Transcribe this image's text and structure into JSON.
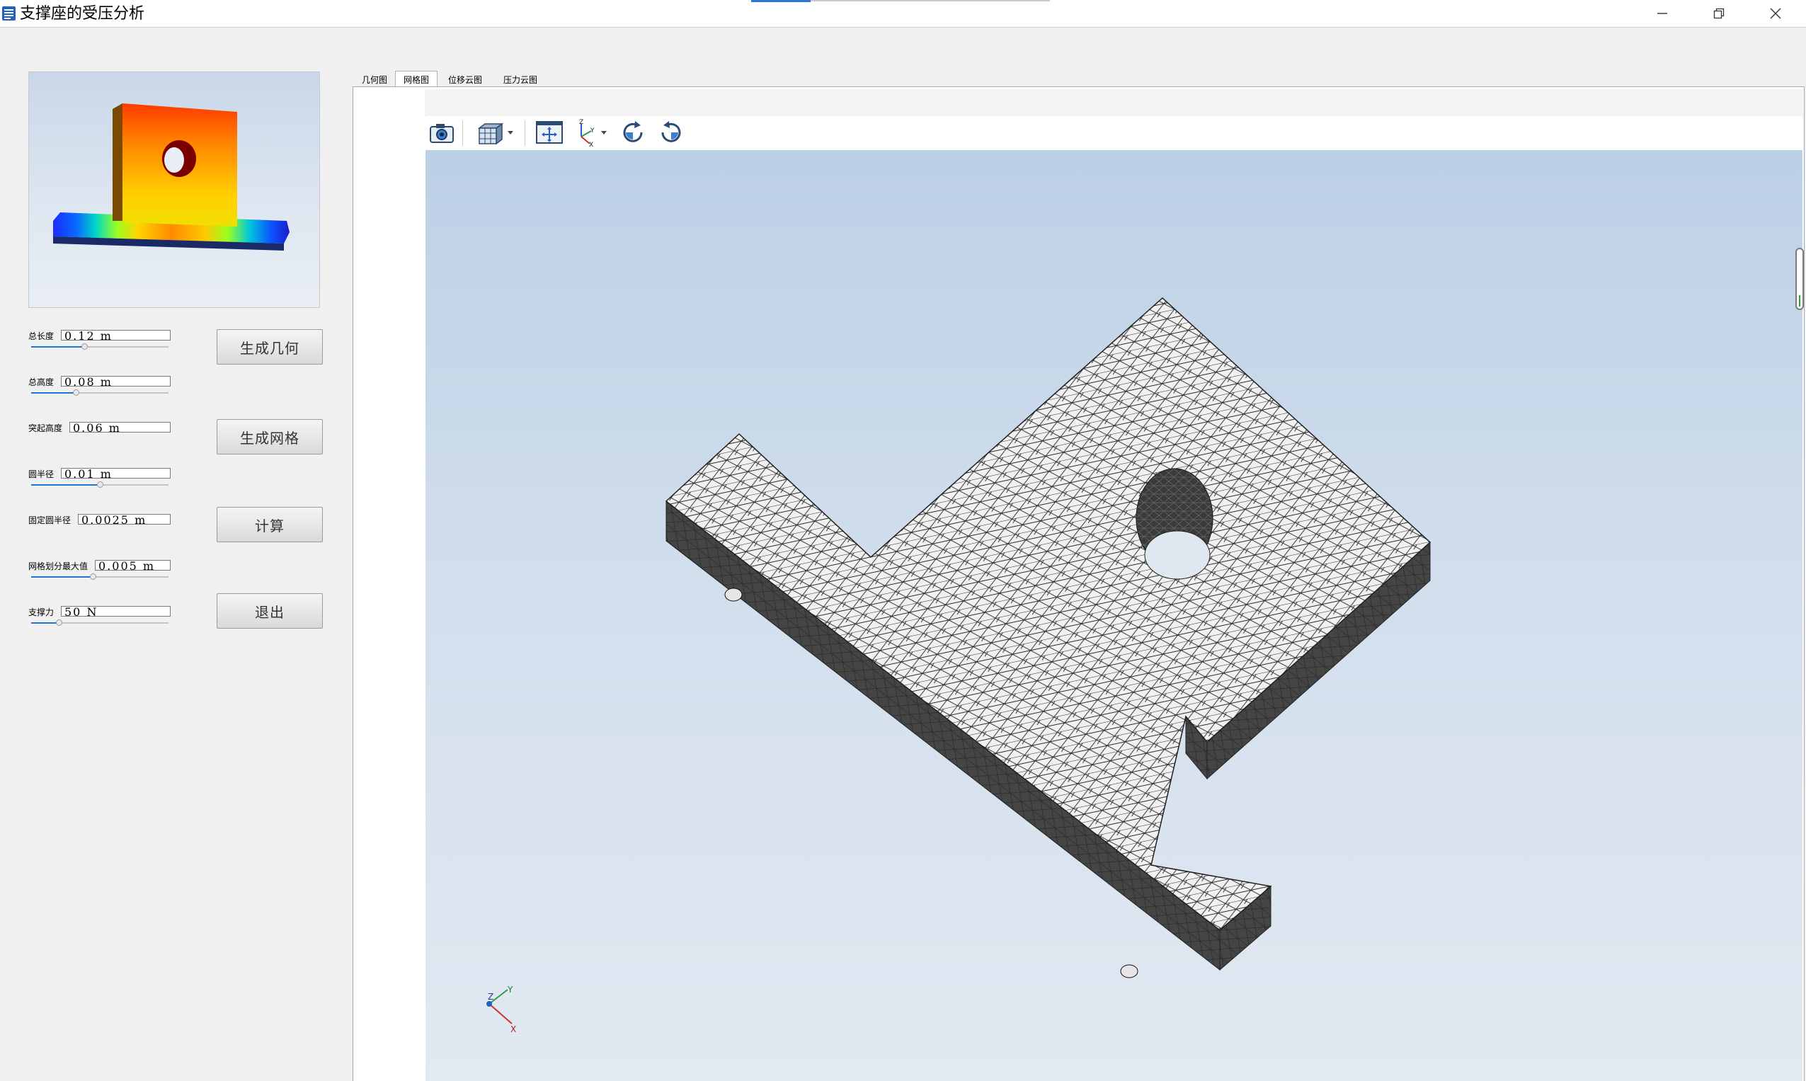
{
  "window": {
    "title": "支撑座的受压分析",
    "controls": [
      "minimize-icon",
      "restore-icon",
      "close-icon"
    ]
  },
  "params": [
    {
      "label": "总长度",
      "value": "0.12 m",
      "slider_fraction": 0.25
    },
    {
      "label": "总高度",
      "value": "0.08 m",
      "slider_fraction": 0.2
    },
    {
      "label": "突起高度",
      "value": "0.06 m",
      "slider_fraction": 0.0
    },
    {
      "label": "圆半径",
      "value": "0.01 m",
      "slider_fraction": 0.5
    },
    {
      "label": "固定圆半径",
      "value": "0.0025 m",
      "slider_fraction": 0.0
    },
    {
      "label": "网格划分最大值",
      "value": "0.005 m",
      "slider_fraction": 0.45
    },
    {
      "label": "支撑力",
      "value": "50 N",
      "slider_fraction": 0.15
    }
  ],
  "buttons": {
    "generate_geometry": "生成几何",
    "generate_mesh": "生成网格",
    "compute": "计算",
    "exit": "退出"
  },
  "tabs": [
    {
      "label": "几何图",
      "active": false
    },
    {
      "label": "网格图",
      "active": true
    },
    {
      "label": "位移云图",
      "active": false
    },
    {
      "label": "压力云图",
      "active": false
    }
  ],
  "toolbar": [
    "camera-icon",
    "display-mode-cube-icon",
    "fit-all-icon",
    "axis-view-icon",
    "rotate-cw-icon",
    "rotate-ccw-icon"
  ],
  "axes": {
    "x": "X",
    "y": "Y",
    "z": "Z"
  },
  "colors": {
    "accent": "#2a78d6",
    "mesh_face": "#f2f2f2",
    "mesh_side": "#4a4a4a",
    "viewport_top": "#bcd0e6",
    "viewport_bottom": "#e2e9f2"
  }
}
